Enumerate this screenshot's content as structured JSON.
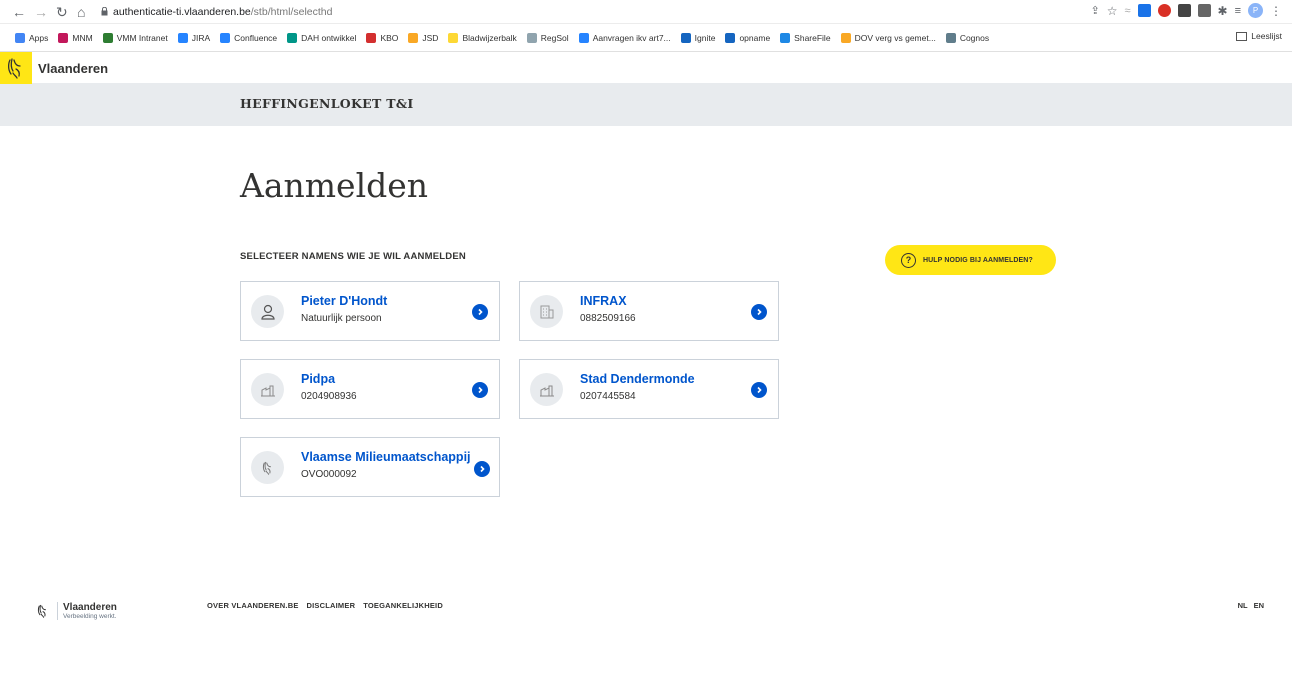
{
  "browser": {
    "url_host": "authenticatie-ti.vlaanderen.be",
    "url_path": "/stb/html/selecthd",
    "bookmarks": [
      {
        "label": "Apps",
        "color": "#4285f4"
      },
      {
        "label": "MNM",
        "color": "#c2185b"
      },
      {
        "label": "VMM Intranet",
        "color": "#2e7d32"
      },
      {
        "label": "JIRA",
        "color": "#2684ff"
      },
      {
        "label": "Confluence",
        "color": "#2684ff"
      },
      {
        "label": "DAH ontwikkel",
        "color": "#009688"
      },
      {
        "label": "KBO",
        "color": "#d32f2f"
      },
      {
        "label": "JSD",
        "color": "#f9a825"
      },
      {
        "label": "Bladwijzerbalk",
        "color": "#fdd835"
      },
      {
        "label": "RegSol",
        "color": "#90a4ae"
      },
      {
        "label": "Aanvragen ikv art7...",
        "color": "#2684ff"
      },
      {
        "label": "Ignite",
        "color": "#1565c0"
      },
      {
        "label": "opname",
        "color": "#1565c0"
      },
      {
        "label": "ShareFile",
        "color": "#1e88e5"
      },
      {
        "label": "DOV verg vs gemet...",
        "color": "#f9a825"
      },
      {
        "label": "Cognos",
        "color": "#607d8b"
      }
    ],
    "reading_list": "Leeslijst",
    "profile_initial": "P"
  },
  "header": {
    "brand": "Vlaanderen",
    "band_title": "HEFFINGENLOKET T&I"
  },
  "main": {
    "title": "Aanmelden",
    "section_label": "SELECTEER NAMENS WIE JE WIL AANMELDEN",
    "help_label": "HULP NODIG BIJ AANMELDEN?",
    "help_icon": "?",
    "cards": [
      {
        "name": "Pieter D'Hondt",
        "sub": "Natuurlijk persoon",
        "icon": "person-icon"
      },
      {
        "name": "INFRAX",
        "sub": "0882509166",
        "icon": "building-icon"
      },
      {
        "name": "Pidpa",
        "sub": "0204908936",
        "icon": "factory-icon"
      },
      {
        "name": "Stad Dendermonde",
        "sub": "0207445584",
        "icon": "factory-icon"
      },
      {
        "name": "Vlaamse Milieumaatschappij",
        "sub": "OVO000092",
        "icon": "vlaanderen-lion-icon"
      }
    ]
  },
  "footer": {
    "brand": "Vlaanderen",
    "tagline": "Verbeelding werkt.",
    "links": [
      "OVER VLAANDEREN.BE",
      "DISCLAIMER",
      "TOEGANKELIJKHEID"
    ],
    "languages": [
      "NL",
      "EN"
    ]
  },
  "colors": {
    "accent_yellow": "#ffe615",
    "link_blue": "#0055cc",
    "band_grey": "#e8ebee"
  }
}
